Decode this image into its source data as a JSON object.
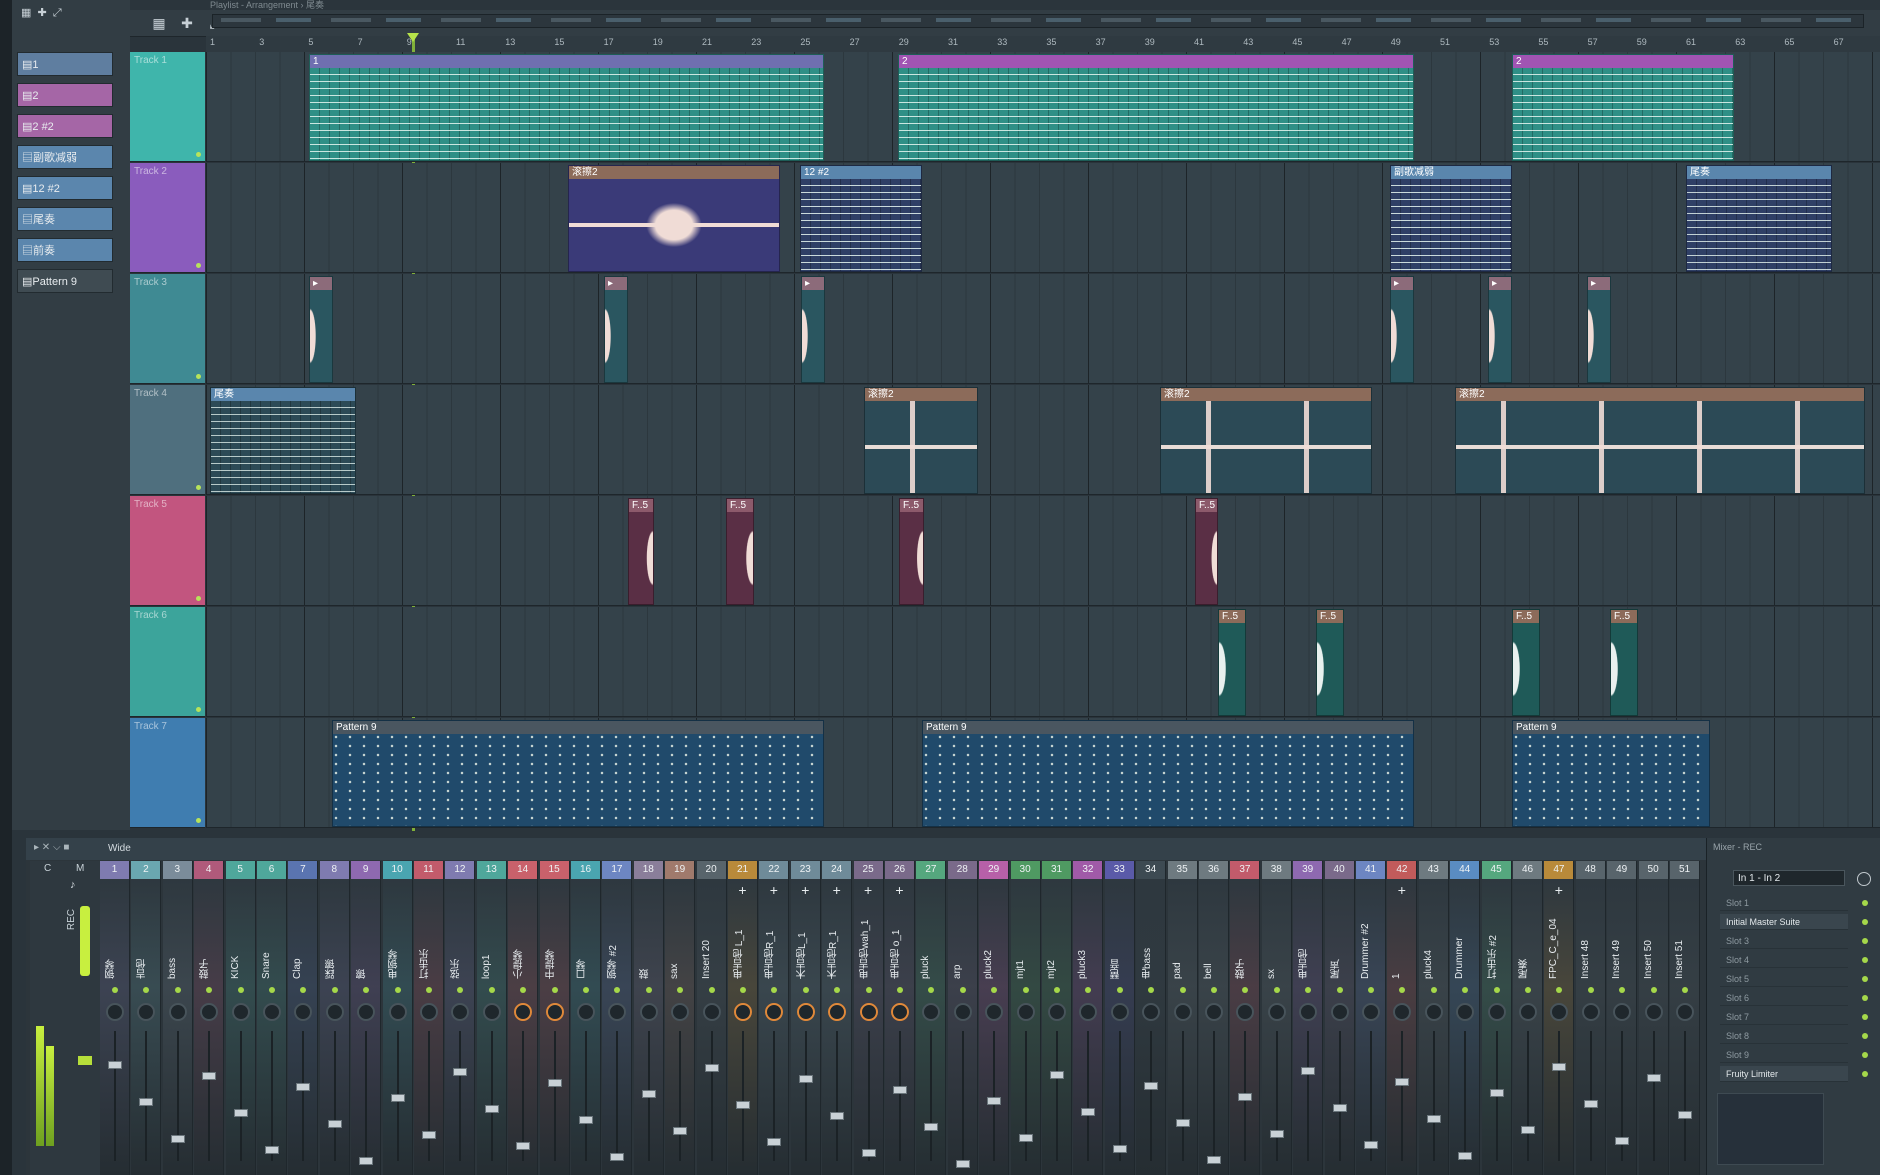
{
  "window": {
    "playlist_title": "Playlist - Arrangement › 尾奏",
    "mixer_title": "Mixer - REC"
  },
  "picker": [
    "1",
    "2",
    "2 #2",
    "副歌减弱",
    "12 #2",
    "尾奏",
    "前奏",
    "Pattern 9"
  ],
  "ruler": [
    "1",
    "3",
    "5",
    "7",
    "9",
    "11",
    "13",
    "15",
    "17",
    "19",
    "21",
    "23",
    "25",
    "27",
    "29",
    "31",
    "33",
    "35",
    "37",
    "39",
    "41",
    "43",
    "45",
    "47",
    "49",
    "51",
    "53",
    "55",
    "57",
    "59",
    "61",
    "63",
    "65",
    "67"
  ],
  "tracks": [
    "Track 1",
    "Track 2",
    "Track 3",
    "Track 4",
    "Track 5",
    "Track 6",
    "Track 7"
  ],
  "clip_labels": {
    "p1": "1",
    "p2": "2",
    "scroll": "滚擦2",
    "p12": "12 #2",
    "chorus": "副歌减弱",
    "outro": "尾奏",
    "fx": "F..5",
    "pat9": "Pattern 9"
  },
  "mixer": {
    "wide_label": "Wide",
    "master_labels": [
      "C",
      "M"
    ],
    "rec_label": "REC",
    "channels": [
      {
        "n": "1",
        "name": "钢琴",
        "color": "#7f7bb0"
      },
      {
        "n": "2",
        "name": "吉他",
        "color": "#6aa7b0"
      },
      {
        "n": "3",
        "name": "bass",
        "color": "#7b8c9a"
      },
      {
        "n": "4",
        "name": "鼓子",
        "color": "#b05a7b"
      },
      {
        "n": "5",
        "name": "KICK",
        "color": "#4fa79b"
      },
      {
        "n": "6",
        "name": "Snare",
        "color": "#4fa79b"
      },
      {
        "n": "7",
        "name": "Clap",
        "color": "#5a74b0"
      },
      {
        "n": "8",
        "name": "踩镲",
        "color": "#7f7bb0"
      },
      {
        "n": "9",
        "name": "镲",
        "color": "#8e69b0"
      },
      {
        "n": "10",
        "name": "电钢琴",
        "color": "#4aa5b0"
      },
      {
        "n": "11",
        "name": "打击乐",
        "color": "#c25b6b"
      },
      {
        "n": "12",
        "name": "弦乐",
        "color": "#7f7bb0"
      },
      {
        "n": "13",
        "name": "loop1",
        "color": "#4fa79b"
      },
      {
        "n": "14",
        "name": "小提琴",
        "color": "#c9616b"
      },
      {
        "n": "15",
        "name": "中提琴",
        "color": "#c9616b"
      },
      {
        "n": "16",
        "name": "口琴",
        "color": "#4aa5b0"
      },
      {
        "n": "17",
        "name": "钢琴 #2",
        "color": "#6d86c2"
      },
      {
        "n": "18",
        "name": "鼓",
        "color": "#8a7e9a"
      },
      {
        "n": "19",
        "name": "sax",
        "color": "#a07a6c"
      },
      {
        "n": "20",
        "name": "Insert 20",
        "color": "#58646b"
      },
      {
        "n": "21",
        "name": "电吉他 L_1",
        "color": "#b98a3a"
      },
      {
        "n": "22",
        "name": "电吉他R_1",
        "color": "#6f8b99"
      },
      {
        "n": "23",
        "name": "木吉他L_1",
        "color": "#6f8b99"
      },
      {
        "n": "24",
        "name": "木吉他R_1",
        "color": "#6f8b99"
      },
      {
        "n": "25",
        "name": "电吉他wah_1",
        "color": "#7a6a8a"
      },
      {
        "n": "26",
        "name": "电吉他 o_1",
        "color": "#7a6a8a"
      },
      {
        "n": "27",
        "name": "pluck",
        "color": "#55a77e"
      },
      {
        "n": "28",
        "name": "arp",
        "color": "#7a6a8a"
      },
      {
        "n": "29",
        "name": "pluck2",
        "color": "#b760a8"
      },
      {
        "n": "30",
        "name": "mjt1",
        "color": "#4f9a62"
      },
      {
        "n": "31",
        "name": "mjt2",
        "color": "#4f9a62"
      },
      {
        "n": "32",
        "name": "pluck3",
        "color": "#a05aa8"
      },
      {
        "n": "33",
        "name": "琶音",
        "color": "#5a5aa8"
      },
      {
        "n": "34",
        "name": "电bass",
        "color": "#3d4a52"
      },
      {
        "n": "35",
        "name": "pad",
        "color": "#6e7a80"
      },
      {
        "n": "36",
        "name": "bell",
        "color": "#6e7a80"
      },
      {
        "n": "37",
        "name": "鼓子",
        "color": "#c25b6b"
      },
      {
        "n": "38",
        "name": "sx",
        "color": "#6e7a80"
      },
      {
        "n": "39",
        "name": "电吉他",
        "color": "#8e69b0"
      },
      {
        "n": "40",
        "name": "尾声",
        "color": "#7a6a8a"
      },
      {
        "n": "41",
        "name": "Drummer #2",
        "color": "#6d86c2"
      },
      {
        "n": "42",
        "name": "1",
        "color": "#c25b5b"
      },
      {
        "n": "43",
        "name": "pluck4",
        "color": "#6e7a80"
      },
      {
        "n": "44",
        "name": "Drummer",
        "color": "#5a8cc2"
      },
      {
        "n": "45",
        "name": "打击乐 #2",
        "color": "#55a77e"
      },
      {
        "n": "46",
        "name": "尾奏",
        "color": "#6e7a80"
      },
      {
        "n": "47",
        "name": "FPC_C_e_04",
        "color": "#b98a3a"
      },
      {
        "n": "48",
        "name": "Insert 48",
        "color": "#58646b"
      },
      {
        "n": "49",
        "name": "Insert 49",
        "color": "#58646b"
      },
      {
        "n": "50",
        "name": "Insert 50",
        "color": "#58646b"
      },
      {
        "n": "51",
        "name": "Insert 51",
        "color": "#58646b"
      }
    ],
    "input": "In 1 - In 2",
    "slots": [
      "Slot 1",
      "Initial Master Suite",
      "Slot 3",
      "Slot 4",
      "Slot 5",
      "Slot 6",
      "Slot 7",
      "Slot 8",
      "Slot 9",
      "Fruity Limiter"
    ]
  }
}
